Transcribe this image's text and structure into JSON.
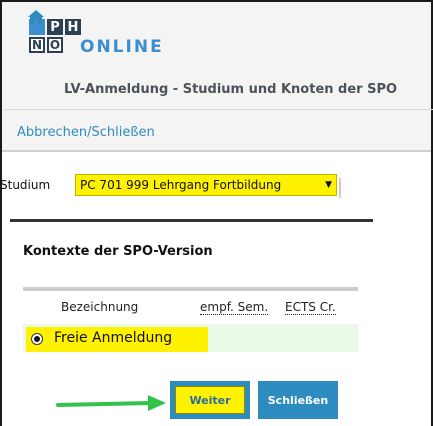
{
  "logo": {
    "letters_top": [
      "P",
      "H"
    ],
    "letters_bottom": [
      "N",
      "Ö"
    ],
    "text": "ONLINE"
  },
  "header": {
    "title": "LV-Anmeldung - Studium und Knoten der SPO"
  },
  "actions": {
    "cancel_close": "Abbrechen/Schließen"
  },
  "studium": {
    "label": "Studium",
    "selected": "PC 701 999 Lehrgang Fortbildung"
  },
  "panel": {
    "title": "Kontexte der SPO-Version",
    "columns": [
      "Bezeichnung",
      "empf. Sem.",
      "ECTS Cr."
    ],
    "rows": [
      {
        "label": "Freie Anmeldung",
        "selected": true
      }
    ]
  },
  "buttons": {
    "next": "Weiter",
    "close": "Schließen"
  },
  "colors": {
    "accent_blue": "#2e8bc0",
    "highlight_yellow": "#fff200",
    "row_green": "#e9fbe6",
    "arrow_green": "#35c24a"
  }
}
